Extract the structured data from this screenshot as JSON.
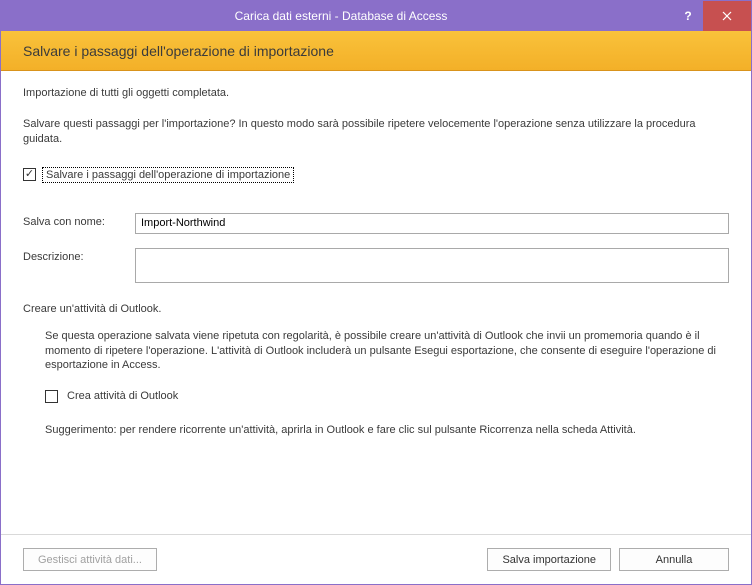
{
  "window": {
    "title": "Carica dati esterni - Database di Access"
  },
  "header": {
    "title": "Salvare i passaggi dell'operazione di importazione"
  },
  "status": "Importazione di tutti gli oggetti completata.",
  "question": "Salvare questi passaggi per l'importazione? In questo modo sarà possibile ripetere velocemente l'operazione senza utilizzare la procedura guidata.",
  "save_steps": {
    "checked": true,
    "label": "Salvare i passaggi dell'operazione di importazione"
  },
  "form": {
    "name_label": "Salva con nome:",
    "name_value": "Import-Northwind",
    "desc_label": "Descrizione:",
    "desc_value": ""
  },
  "outlook": {
    "title": "Creare un'attività di Outlook.",
    "desc": "Se questa operazione salvata viene ripetuta con regolarità, è possibile creare un'attività di Outlook che invii un promemoria quando è il momento di ripetere l'operazione. L'attività di Outlook includerà un pulsante Esegui esportazione, che consente di eseguire l'operazione di esportazione in Access.",
    "checkbox_checked": false,
    "checkbox_label": "Crea attività di Outlook",
    "tip": "Suggerimento: per rendere ricorrente un'attività, aprirla in Outlook e fare clic sul pulsante Ricorrenza nella scheda Attività."
  },
  "footer": {
    "manage_label": "Gestisci attività dati...",
    "save_label": "Salva importazione",
    "cancel_label": "Annulla"
  }
}
